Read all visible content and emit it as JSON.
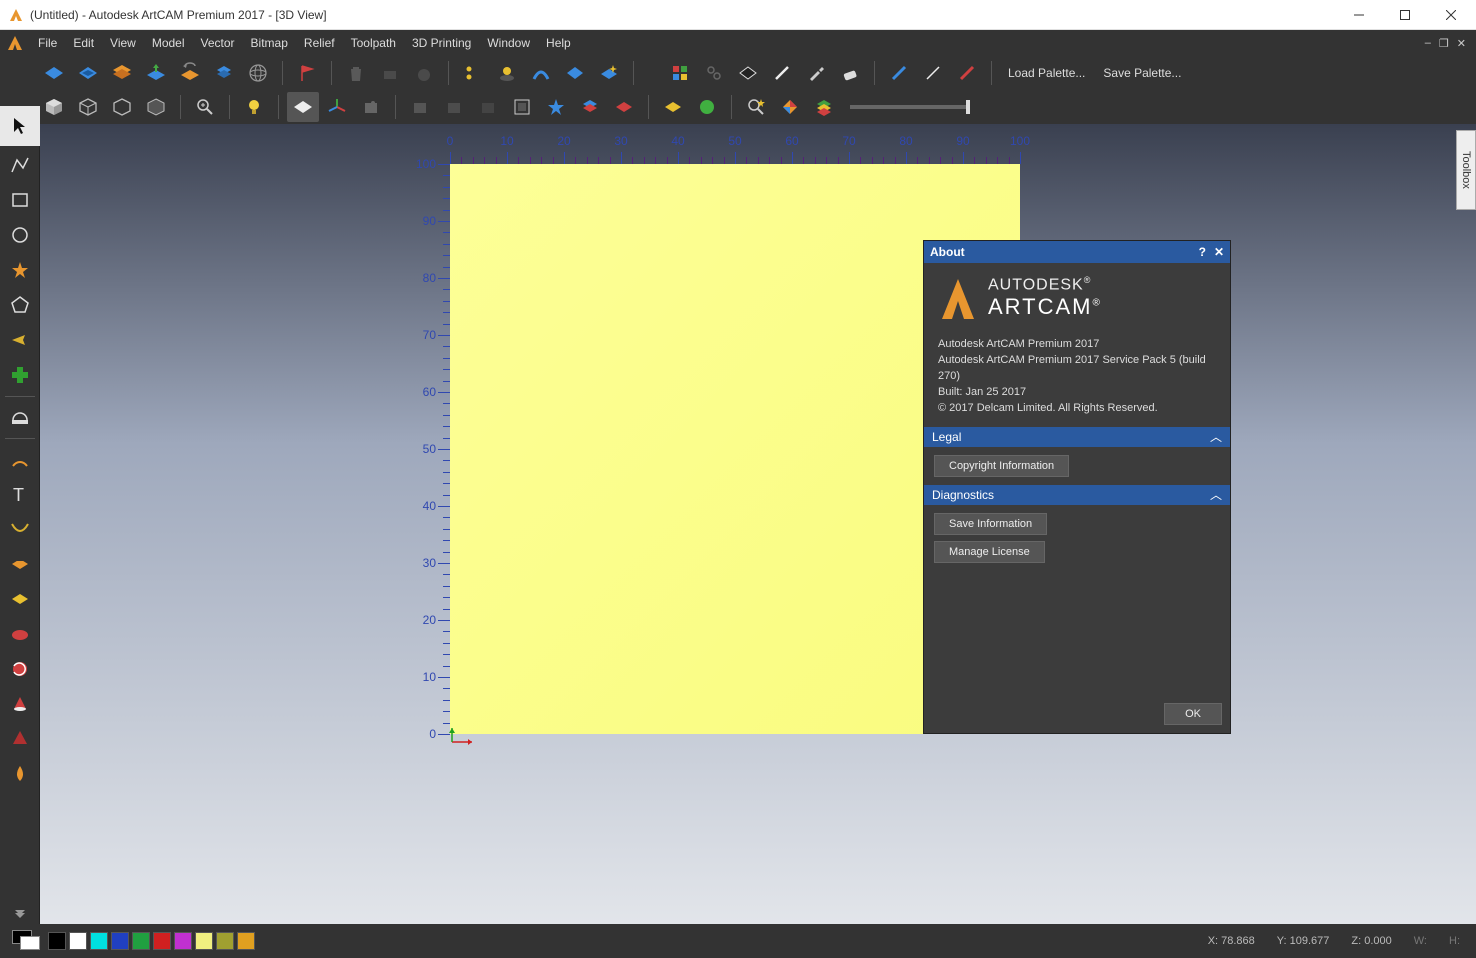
{
  "titlebar": {
    "title": "(Untitled) - Autodesk ArtCAM Premium 2017 - [3D View]"
  },
  "menubar": {
    "items": [
      "File",
      "Edit",
      "View",
      "Model",
      "Vector",
      "Bitmap",
      "Relief",
      "Toolpath",
      "3D Printing",
      "Window",
      "Help"
    ]
  },
  "toolbar": {
    "loadPalette": "Load Palette...",
    "savePalette": "Save Palette..."
  },
  "toolbox_tab": "Toolbox",
  "ruler": {
    "ticks": [
      "0",
      "10",
      "20",
      "30",
      "40",
      "50",
      "60",
      "70",
      "80",
      "90",
      "100"
    ]
  },
  "about": {
    "title": "About",
    "brand_top": "AUTODESK",
    "brand_reg": "®",
    "brand_bottom": "ARTCAM",
    "brand_tm": "®",
    "lines": [
      "Autodesk ArtCAM Premium 2017",
      "Autodesk ArtCAM Premium 2017 Service Pack 5 (build 270)",
      "Built: Jan 25 2017",
      "© 2017 Delcam Limited. All Rights Reserved."
    ],
    "legal": {
      "title": "Legal",
      "copyright": "Copyright Information"
    },
    "diag": {
      "title": "Diagnostics",
      "save": "Save Information",
      "license": "Manage License"
    },
    "ok": "OK"
  },
  "status": {
    "swatches": [
      "#000000",
      "#ffffff",
      "#00e0e0",
      "#2040c0",
      "#20a040",
      "#d02020",
      "#c030d0",
      "#f0f080",
      "#a0a030",
      "#e0a020"
    ],
    "coords": {
      "x": "X: 78.868",
      "y": "Y: 109.677",
      "z": "Z: 0.000",
      "w": "W:",
      "h": "H:"
    }
  }
}
